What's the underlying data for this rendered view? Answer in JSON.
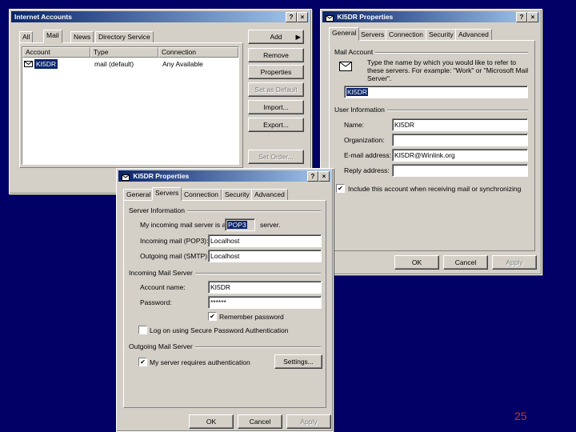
{
  "page_number": "25",
  "accounts_window": {
    "title": "Internet Accounts",
    "title_buttons": [
      "?",
      "×"
    ],
    "tabs": [
      "All",
      "Mail",
      "News",
      "Directory Service"
    ],
    "columns": [
      "Account",
      "Type",
      "Connection"
    ],
    "rows": [
      {
        "account": "KI5DR",
        "type": "mail (default)",
        "connection": "Any Available"
      }
    ],
    "buttons": {
      "add": "Add",
      "remove": "Remove",
      "properties": "Properties",
      "set_default": "Set as Default",
      "import": "Import...",
      "export": "Export...",
      "set_order": "Set Order..."
    }
  },
  "general_window": {
    "title": "KI5DR Properties",
    "title_buttons": [
      "?",
      "×"
    ],
    "tabs": [
      "General",
      "Servers",
      "Connection",
      "Security",
      "Advanced"
    ],
    "mail_account_group": "Mail Account",
    "mail_account_desc": "Type the name by which you would like to refer to these servers. For example: \"Work\" or \"Microsoft Mail Server\".",
    "account_name_value": "KI5DR",
    "user_info_group": "User Information",
    "name_label": "Name:",
    "name_value": "KI5DR",
    "organization_label": "Organization:",
    "organization_value": "",
    "email_label": "E-mail address:",
    "email_value": "KI5DR@Winlink.org",
    "reply_label": "Reply address:",
    "reply_value": "",
    "include_check": "Include this account when receiving mail or synchronizing",
    "ok": "OK",
    "cancel": "Cancel",
    "apply": "Apply"
  },
  "servers_window": {
    "title": "KI5DR Properties",
    "title_buttons": [
      "?",
      "×"
    ],
    "tabs": [
      "General",
      "Servers",
      "Connection",
      "Security",
      "Advanced"
    ],
    "server_info_group": "Server Information",
    "incoming_is_prefix": "My incoming mail server is a",
    "incoming_type": "POP3",
    "incoming_is_suffix": "server.",
    "incoming_label": "Incoming mail (POP3):",
    "incoming_value": "Localhost",
    "outgoing_label": "Outgoing mail (SMTP):",
    "outgoing_value": "Localhost",
    "incoming_server_group": "Incoming Mail Server",
    "account_name_label": "Account name:",
    "account_name_value": "KI5DR",
    "password_label": "Password:",
    "password_value": "******",
    "remember_password": "Remember password",
    "spa_check": "Log on using Secure Password Authentication",
    "outgoing_server_group": "Outgoing Mail Server",
    "auth_check": "My server requires authentication",
    "settings_button": "Settings...",
    "ok": "OK",
    "cancel": "Cancel",
    "apply": "Apply"
  }
}
